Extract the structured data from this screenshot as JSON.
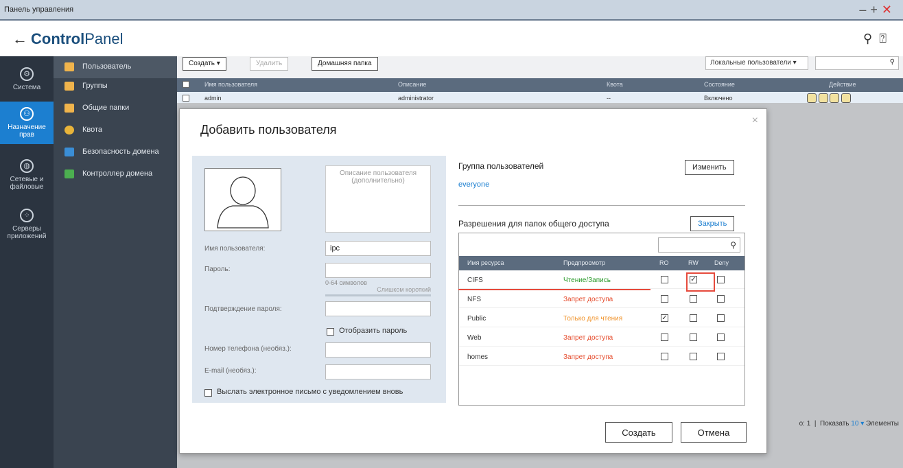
{
  "window": {
    "title": "Панель управления"
  },
  "header": {
    "back": "←",
    "brand_bold": "Control",
    "brand_light": "Panel"
  },
  "rail": [
    {
      "label": "Система",
      "icon": "gear-icon"
    },
    {
      "label": "Назначение прав",
      "icon": "user-icon"
    },
    {
      "label": "Сетевые и файловые",
      "icon": "network-icon"
    },
    {
      "label": "Серверы приложений",
      "icon": "apps-icon"
    }
  ],
  "sidebar": {
    "items": [
      {
        "label": "Пользователь",
        "color": "#f0b44c"
      },
      {
        "label": "Группы",
        "color": "#f0b44c"
      },
      {
        "label": "Общие папки",
        "color": "#f0b44c"
      },
      {
        "label": "Квота",
        "color": "#e8b43a"
      },
      {
        "label": "Безопасность домена",
        "color": "#3a8ed6"
      },
      {
        "label": "Контроллер домена",
        "color": "#4caf50"
      }
    ]
  },
  "toolbar": {
    "create": "Создать ▾",
    "delete": "Удалить",
    "home_folder": "Домашняя папка",
    "filter": "Локальные пользователи ▾"
  },
  "table": {
    "headers": [
      "Имя пользователя",
      "Описание",
      "Квота",
      "Состояние",
      "Действие"
    ],
    "rows": [
      {
        "name": "admin",
        "desc": "administrator",
        "quota": "--",
        "state": "Включено"
      }
    ]
  },
  "pager": {
    "prefix": "о: 1",
    "show": "Показать",
    "count": "10",
    "suffix": "Элементы"
  },
  "dialog": {
    "title": "Добавить пользователя",
    "close": "×",
    "description_placeholder": "Описание пользователя (дополнительно)",
    "username_label": "Имя пользователя:",
    "username_value": "ipc",
    "password_label": "Пароль:",
    "password_hint": "0-64 символов",
    "password_strength": "Слишком короткий",
    "confirm_label": "Подтверждение пароля:",
    "show_password": "Отобразить пароль",
    "phone_label": "Номер телефона (необяз.):",
    "email_label": "E-mail (необяз.):",
    "send_email": "Выслать электронное письмо с уведомлением вновь",
    "group_title": "Группа пользователей",
    "change_button": "Изменить",
    "group_value": "everyone",
    "perm_title": "Разрешения для папок общего доступа",
    "close_button": "Закрыть",
    "share_headers": [
      "Имя ресурса",
      "Предпросмотр",
      "RO",
      "RW",
      "Deny"
    ],
    "shares": [
      {
        "name": "CIFS",
        "preview": "Чтение/Запись",
        "ro": false,
        "rw": true,
        "deny": false
      },
      {
        "name": "NFS",
        "preview": "Запрет доступа",
        "ro": false,
        "rw": false,
        "deny": false
      },
      {
        "name": "Public",
        "preview": "Только для чтения",
        "ro": true,
        "rw": false,
        "deny": false
      },
      {
        "name": "Web",
        "preview": "Запрет доступа",
        "ro": false,
        "rw": false,
        "deny": false
      },
      {
        "name": "homes",
        "preview": "Запрет доступа",
        "ro": false,
        "rw": false,
        "deny": false
      }
    ],
    "create_button": "Создать",
    "cancel_button": "Отмена"
  }
}
